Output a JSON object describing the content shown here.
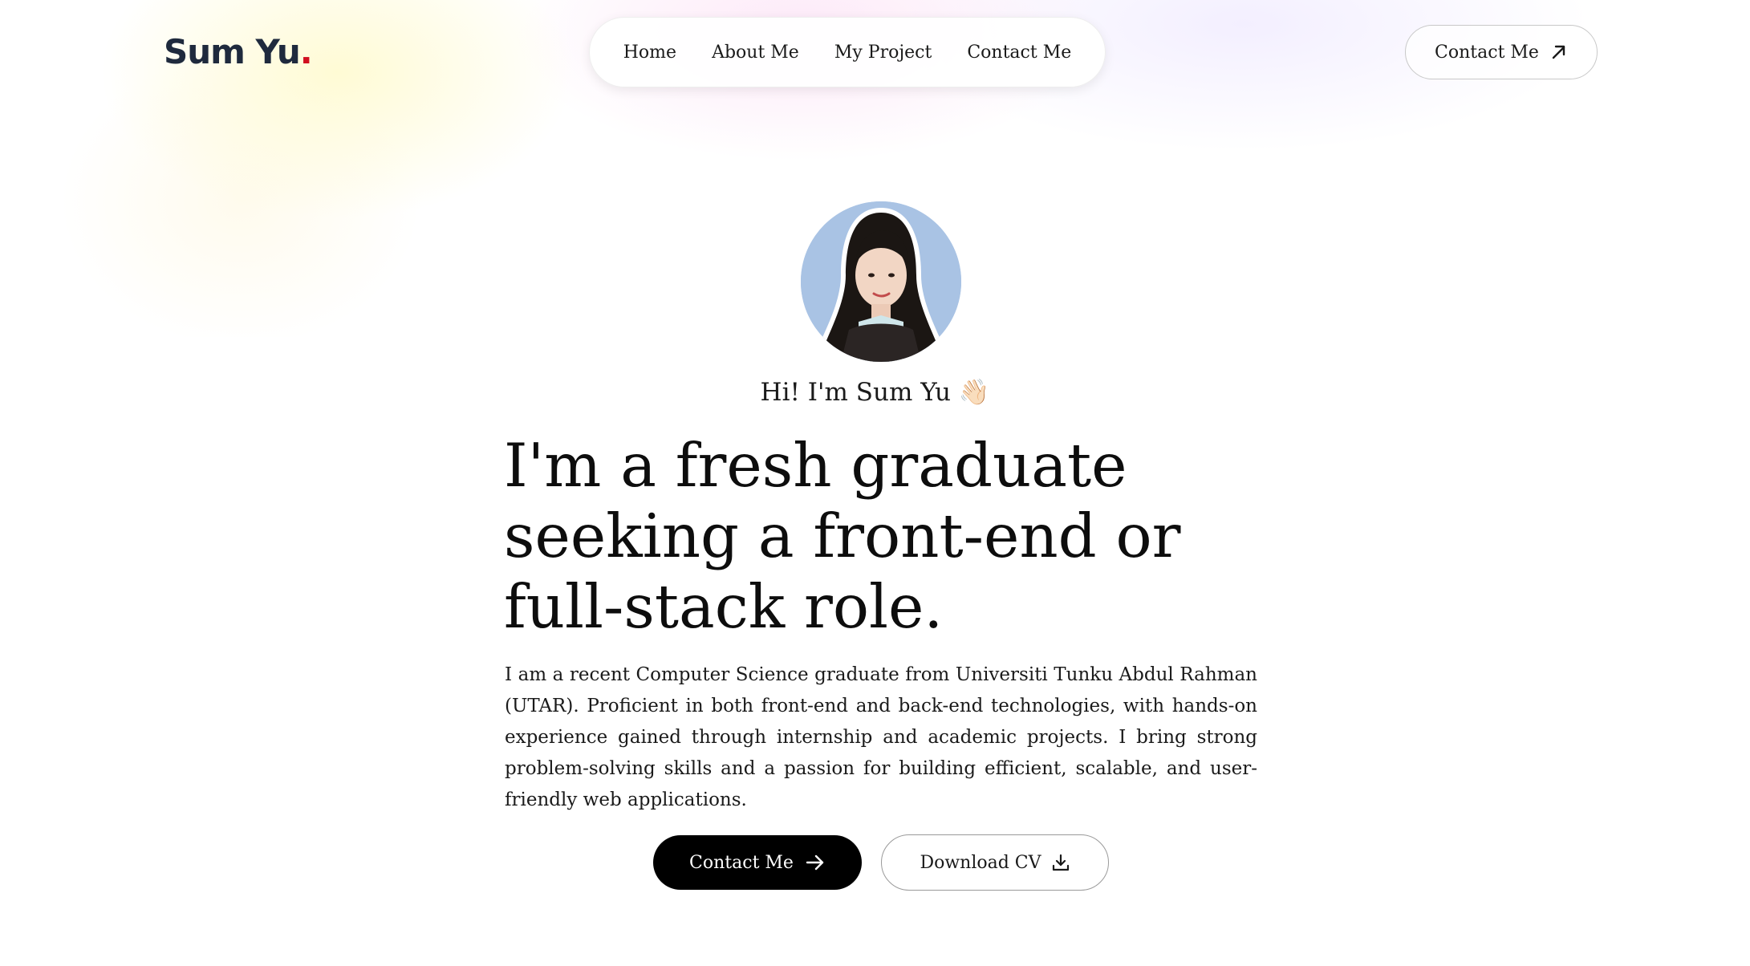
{
  "header": {
    "logo_text": "Sum Yu",
    "logo_dot": ".",
    "nav": [
      {
        "label": "Home"
      },
      {
        "label": "About Me"
      },
      {
        "label": "My Project"
      },
      {
        "label": "Contact Me"
      }
    ],
    "contact_button_label": "Contact Me",
    "contact_button_icon": "arrow-up-right-icon"
  },
  "hero": {
    "avatar_alt": "profile photo",
    "greeting": "Hi! I'm Sum Yu 👋🏻",
    "headline_lines": [
      "I'm a fresh graduate",
      "seeking a front-end or",
      "full-stack role."
    ],
    "bio": "I am a recent Computer Science graduate from Universiti Tunku Abdul Rahman (UTAR). Proficient in both front-end and back-end technologies, with hands-on experience gained through internship and academic projects. I bring strong problem-solving skills and a passion for building efficient, scalable, and user-friendly web applications.",
    "primary_button_label": "Contact Me",
    "primary_button_icon": "arrow-right-icon",
    "secondary_button_label": "Download CV",
    "secondary_button_icon": "download-icon"
  },
  "colors": {
    "logo": "#1f2a3d",
    "logo_dot": "#d10f1f",
    "primary_button_bg": "#000000",
    "avatar_bg": "#a9c3e4"
  }
}
